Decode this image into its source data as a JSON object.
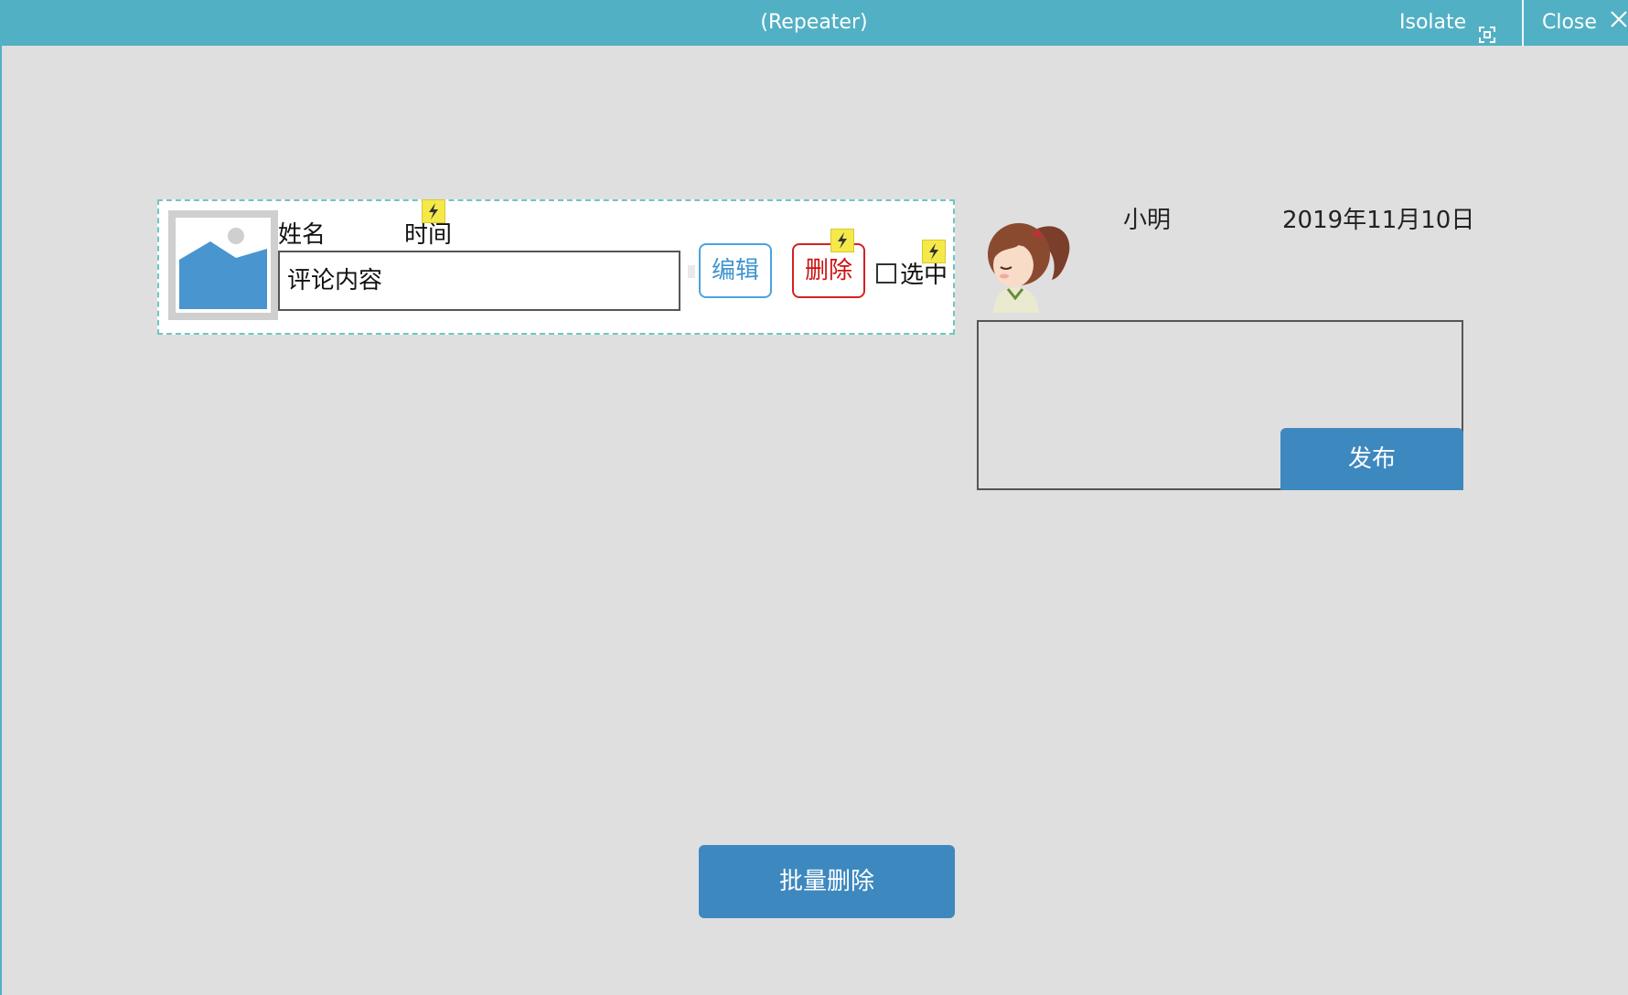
{
  "titlebar": {
    "title": "(Repeater)",
    "isolate_label": "Isolate",
    "close_label": "Close",
    "background": "#52b0c4"
  },
  "repeater_item": {
    "name_label": "姓名",
    "time_label": "时间",
    "comment_placeholder": "评论内容",
    "edit_label": "编辑",
    "delete_label": "删除",
    "select_label": "选中",
    "image_icon": "image-placeholder-icon",
    "interaction_icon": "lightning-icon"
  },
  "post_panel": {
    "user_name": "小明",
    "date": "2019年11月10日",
    "avatar_icon": "anime-girl-avatar",
    "comment_value": "",
    "publish_label": "发布"
  },
  "batch_delete_label": "批量删除",
  "colors": {
    "primary_button": "#3d88bf",
    "edit_border": "#4aa3df",
    "delete_border": "#d32222",
    "canvas": "#dfdfdf"
  }
}
